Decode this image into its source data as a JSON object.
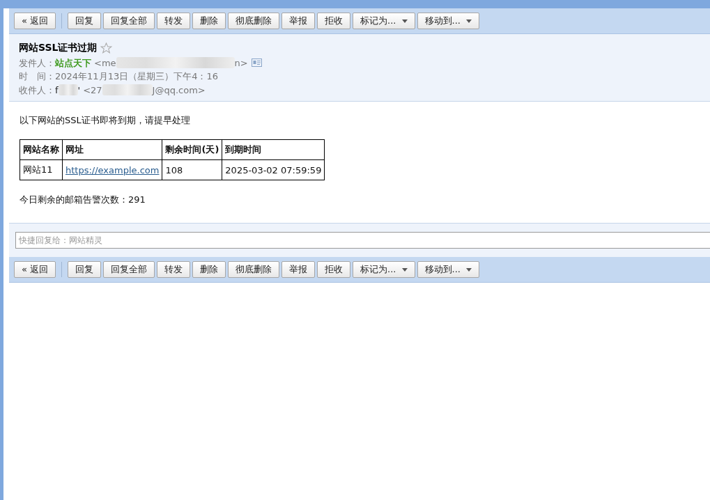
{
  "toolbar_top": {
    "buttons": [
      {
        "label": "« 返回",
        "kind": "button"
      },
      {
        "label": "回复",
        "kind": "button"
      },
      {
        "label": "回复全部",
        "kind": "button"
      },
      {
        "label": "转发",
        "kind": "button"
      },
      {
        "label": "删除",
        "kind": "button"
      },
      {
        "label": "彻底删除",
        "kind": "button"
      },
      {
        "label": "举报",
        "kind": "button"
      },
      {
        "label": "拒收",
        "kind": "button"
      },
      {
        "label": "标记为...",
        "kind": "dropdown"
      },
      {
        "label": "移动到...",
        "kind": "dropdown"
      }
    ]
  },
  "header": {
    "subject": "网站SSL证书过期",
    "starred": false,
    "from": {
      "label": "发件人：",
      "name": "站点天下",
      "email_start": "<me",
      "email_end": "n>"
    },
    "time": {
      "label": "时　间：",
      "value": "2024年11月13日（星期三）下午4：16"
    },
    "to": {
      "label": "收件人：",
      "name_start": "f",
      "name_end": "'",
      "email_start": "<27",
      "email_end": "J@qq.com>"
    }
  },
  "body": {
    "intro": "以下网站的SSL证书即将到期，请提早处理",
    "table": {
      "columns": [
        "网站名称",
        "网址",
        "剩余时间(天)",
        "到期时间"
      ],
      "rows": [
        [
          "网站11",
          "https://example.com",
          "108",
          "2025-03-02 07:59:59"
        ]
      ]
    },
    "footer": "今日剩余的邮箱告警次数：291"
  },
  "quick_reply": {
    "placeholder": "快捷回复给：网站精灵"
  },
  "toolbar_bottom": {
    "buttons": [
      {
        "label": "« 返回",
        "kind": "button"
      },
      {
        "label": "回复",
        "kind": "button"
      },
      {
        "label": "回复全部",
        "kind": "button"
      },
      {
        "label": "转发",
        "kind": "button"
      },
      {
        "label": "删除",
        "kind": "button"
      },
      {
        "label": "彻底删除",
        "kind": "button"
      },
      {
        "label": "举报",
        "kind": "button"
      },
      {
        "label": "拒收",
        "kind": "button"
      },
      {
        "label": "标记为...",
        "kind": "dropdown"
      },
      {
        "label": "移动到...",
        "kind": "dropdown"
      }
    ]
  }
}
